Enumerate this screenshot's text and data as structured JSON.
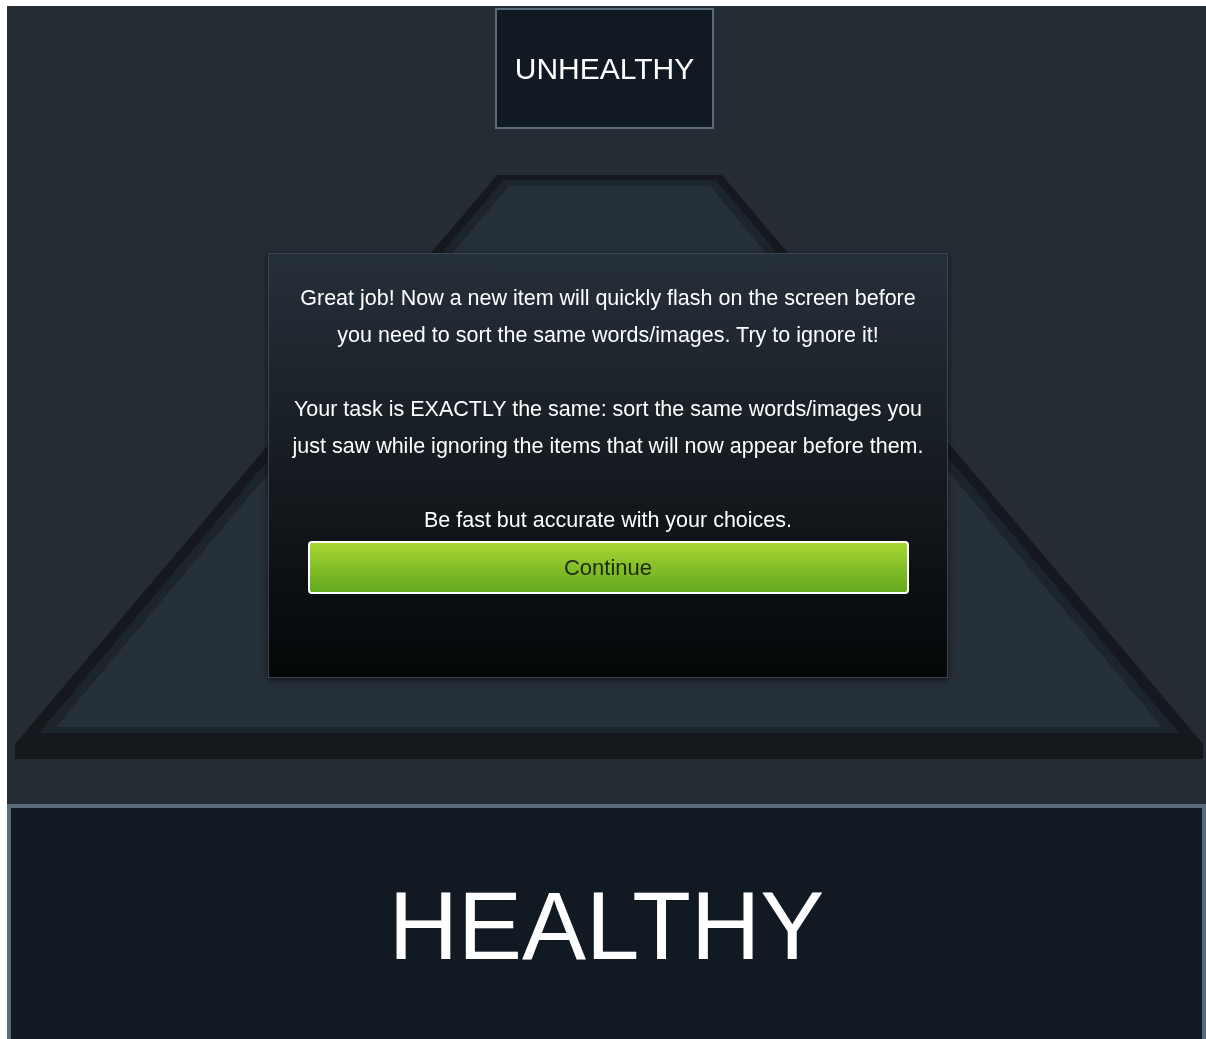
{
  "top_label": "UNHEALTHY",
  "dialog": {
    "paragraphs": [
      "Great job!  Now a new item will quickly flash on the screen before you need to sort the same words/images. Try to ignore it!",
      "Your task is EXACTLY the same: sort the same words/images you just saw while ignoring the items that will now appear before them.",
      "Be fast but accurate with your choices."
    ],
    "button": "Continue"
  },
  "bottom_label": "HEALTHY"
}
